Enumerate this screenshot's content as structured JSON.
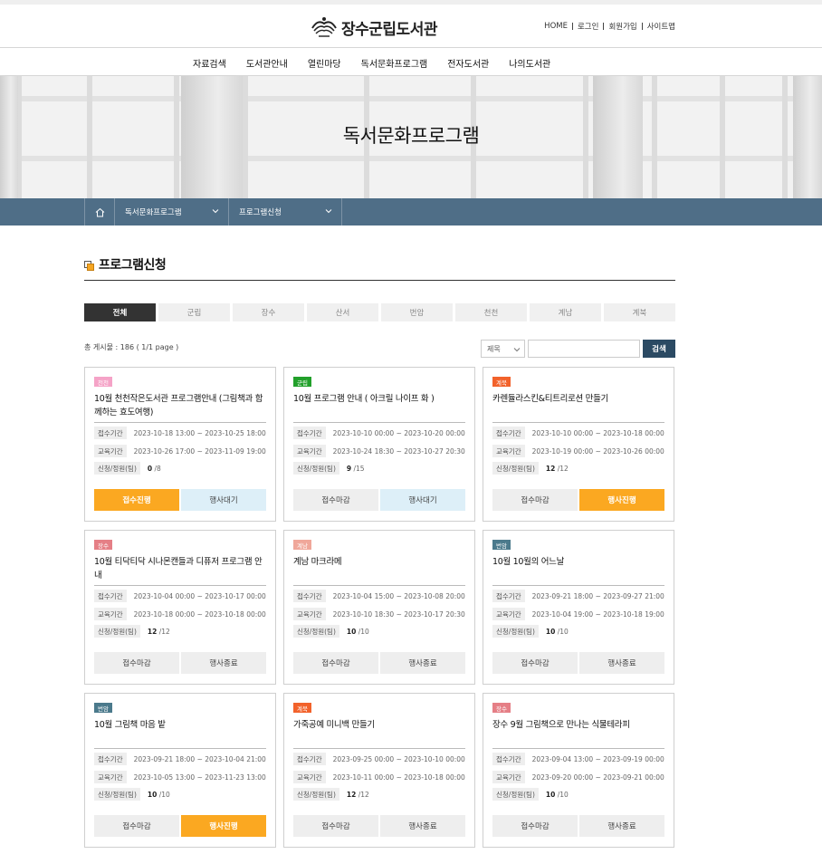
{
  "site": {
    "name": "장수군립도서관"
  },
  "util_links": [
    "HOME",
    "로그인",
    "회원가입",
    "사이트맵"
  ],
  "gnb": [
    "자료검색",
    "도서관안내",
    "열린마당",
    "독서문화프로그램",
    "전자도서관",
    "나의도서관"
  ],
  "visual": {
    "title": "독서문화프로그램"
  },
  "location": {
    "home_icon": "home-icon",
    "level1": "독서문화프로그램",
    "level2": "프로그램신청"
  },
  "page": {
    "title": "프로그램신청"
  },
  "tabs": [
    "전체",
    "군립",
    "장수",
    "산서",
    "번암",
    "천천",
    "계남",
    "계북"
  ],
  "list": {
    "total": "총 게시물 : 186 ( 1/1 page )"
  },
  "search": {
    "select_value": "제목",
    "input_value": "",
    "button": "검색"
  },
  "labels": {
    "reception": "접수기간",
    "education": "교육기간",
    "capacity": "신청/정원(팀)"
  },
  "colors": {
    "orange": "#fba821",
    "lightblue": "#ddeff8",
    "grey": "#eeeeee",
    "navy": "#2b4a63",
    "locbar": "#4f6e87"
  },
  "cards": [
    {
      "badge": "천천",
      "badge_color": "#f5a3c7",
      "title": "10월 천천작은도서관 프로그램안내 (그림책과 함께하는 효도여행)",
      "reception": "2023-10-18 13:00 ~ 2023-10-25 18:00",
      "education": "2023-10-26 17:00 ~ 2023-11-09 19:00",
      "applied": "0",
      "capacity": "/8",
      "btn1": "접수진행",
      "btn1_style": "orange",
      "btn2": "행사대기",
      "btn2_style": "lightblue"
    },
    {
      "badge": "군립",
      "badge_color": "#22a02b",
      "title": "10월 프로그램 안내 ( 아크릴 나이프 화 )",
      "reception": "2023-10-10 00:00 ~ 2023-10-20 00:00",
      "education": "2023-10-24 18:30 ~ 2023-10-27 20:30",
      "applied": "9",
      "capacity": "/15",
      "btn1": "접수마감",
      "btn1_style": "grey",
      "btn2": "행사대기",
      "btn2_style": "lightblue"
    },
    {
      "badge": "계북",
      "badge_color": "#f2622b",
      "title": "카렌듈라스킨&티트리로션 만들기",
      "reception": "2023-10-10 00:00 ~ 2023-10-18 00:00",
      "education": "2023-10-19 00:00 ~ 2023-10-26 00:00",
      "applied": "12",
      "capacity": "/12",
      "btn1": "접수마감",
      "btn1_style": "grey",
      "btn2": "행사진행",
      "btn2_style": "orange"
    },
    {
      "badge": "장수",
      "badge_color": "#e57f86",
      "title": "10월 티닥티닥 시나몬캔들과 디퓨저 프로그램 안내",
      "reception": "2023-10-04 00:00 ~ 2023-10-17 00:00",
      "education": "2023-10-18 00:00 ~ 2023-10-18 00:00",
      "applied": "12",
      "capacity": "/12",
      "btn1": "접수마감",
      "btn1_style": "grey",
      "btn2": "행사종료",
      "btn2_style": "grey"
    },
    {
      "badge": "계남",
      "badge_color": "#f0a79a",
      "title": "계남 마크라메",
      "reception": "2023-10-04 15:00 ~ 2023-10-08 20:00",
      "education": "2023-10-10 18:30 ~ 2023-10-17 20:30",
      "applied": "10",
      "capacity": "/10",
      "btn1": "접수마감",
      "btn1_style": "grey",
      "btn2": "행사종료",
      "btn2_style": "grey"
    },
    {
      "badge": "번암",
      "badge_color": "#4b7a8c",
      "title": "10월 10월의 어느날",
      "reception": "2023-09-21 18:00 ~ 2023-09-27 21:00",
      "education": "2023-10-04 19:00 ~ 2023-10-18 19:00",
      "applied": "10",
      "capacity": "/10",
      "btn1": "접수마감",
      "btn1_style": "grey",
      "btn2": "행사종료",
      "btn2_style": "grey"
    },
    {
      "badge": "번암",
      "badge_color": "#4b7a8c",
      "title": "10월 그림책 마음 밭",
      "reception": "2023-09-21 18:00 ~ 2023-10-04 21:00",
      "education": "2023-10-05 13:00 ~ 2023-11-23 13:00",
      "applied": "10",
      "capacity": "/10",
      "btn1": "접수마감",
      "btn1_style": "grey",
      "btn2": "행사진행",
      "btn2_style": "orange"
    },
    {
      "badge": "계북",
      "badge_color": "#f2622b",
      "title": "가죽공예 미니백 만들기",
      "reception": "2023-09-25 00:00 ~ 2023-10-10 00:00",
      "education": "2023-10-11 00:00 ~ 2023-10-18 00:00",
      "applied": "12",
      "capacity": "/12",
      "btn1": "접수마감",
      "btn1_style": "grey",
      "btn2": "행사종료",
      "btn2_style": "grey"
    },
    {
      "badge": "장수",
      "badge_color": "#e57f86",
      "title": "장수 9월 그림책으로 만나는 식물테라피",
      "reception": "2023-09-04 13:00 ~ 2023-09-19 00:00",
      "education": "2023-09-20 00:00 ~ 2023-09-21 00:00",
      "applied": "10",
      "capacity": "/10",
      "btn1": "접수마감",
      "btn1_style": "grey",
      "btn2": "행사종료",
      "btn2_style": "grey"
    }
  ]
}
